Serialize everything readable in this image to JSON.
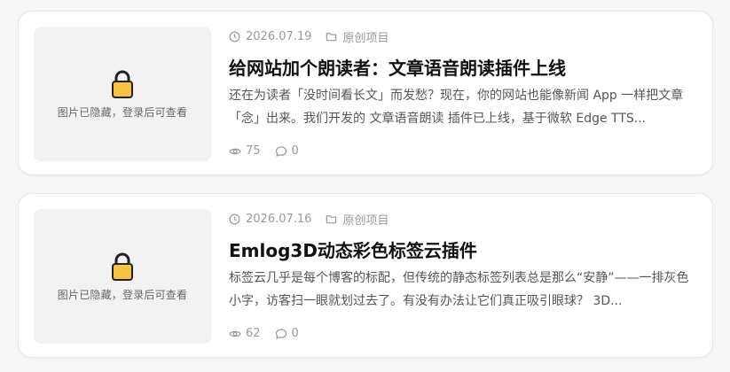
{
  "posts": [
    {
      "thumbnail_hint": "图片已隐藏，登录后可查看",
      "date": "2026.07.19",
      "category": "原创项目",
      "title": "给网站加个朗读者：文章语音朗读插件上线",
      "excerpt": "还在为读者「没时间看长文」而发愁？现在，你的网站也能像新闻 App 一样把文章「念」出来。我们开发的 文章语音朗读 插件已上线，基于微软 Edge TTS...",
      "views": "75",
      "comments": "0"
    },
    {
      "thumbnail_hint": "图片已隐藏，登录后可查看",
      "date": "2026.07.16",
      "category": "原创项目",
      "title": "Emlog3D动态彩色标签云插件",
      "excerpt": "标签云几乎是每个博客的标配，但传统的静态标签列表总是那么“安静”——一排灰色小字，访客扫一眼就划过去了。有没有办法让它们真正吸引眼球？ 3D...",
      "views": "62",
      "comments": "0"
    }
  ],
  "icons": {
    "clock": "clock-icon",
    "folder": "folder-icon",
    "eye": "eye-icon",
    "comment": "comment-icon",
    "lock": "lock-icon"
  },
  "colors": {
    "lock_body": "#f5c242",
    "lock_outline": "#222222",
    "meta_text": "#999999"
  }
}
